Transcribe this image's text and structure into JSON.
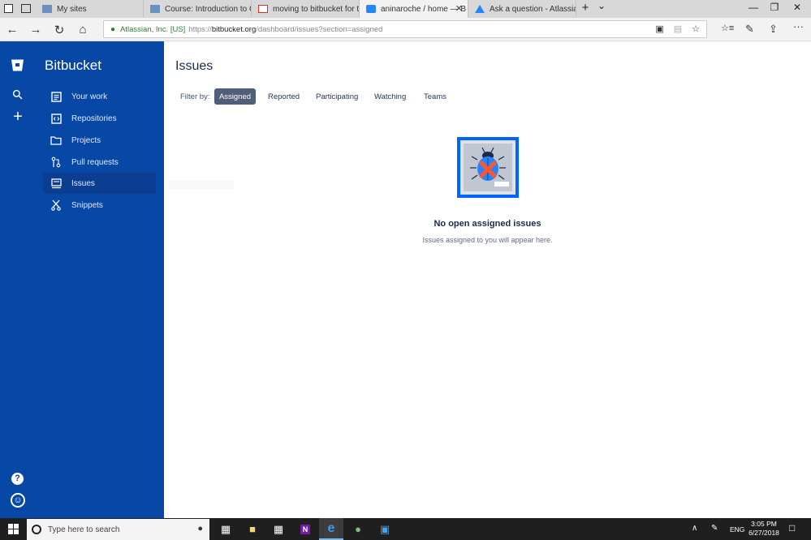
{
  "browser": {
    "tabs": [
      {
        "label": "My sites",
        "favicon": "ucla-icon"
      },
      {
        "label": "Course: Introduction to Gec",
        "favicon": "ucla-icon"
      },
      {
        "label": "moving to bitbucket for trac",
        "favicon": "gmail-icon"
      },
      {
        "label": "aninaroche / home — B",
        "favicon": "bitbucket-icon",
        "active": true
      },
      {
        "label": "Ask a question - Atlassian C",
        "favicon": "atlassian-icon"
      }
    ],
    "new_tab": "+",
    "tab_menu": "⌄",
    "window_controls": {
      "minimize": "—",
      "maximize": "❐",
      "close": "✕"
    },
    "nav": {
      "back": "←",
      "forward": "→",
      "refresh": "↻",
      "home": "⌂"
    },
    "address": {
      "org": "Atlassian, Inc. [US]",
      "scheme": "https://",
      "host": "bitbucket.org",
      "path": "/dashboard/issues?section=assigned"
    },
    "right_icons": {
      "reading": "▤",
      "favorite": "☆",
      "hub": "☆≡",
      "notes": "✎",
      "share": "⇪",
      "more": "···"
    }
  },
  "sidebar": {
    "brand": "Bitbucket",
    "rail": {
      "search": "⚲",
      "create": "+",
      "help": "?",
      "profile": "☺"
    },
    "items": [
      {
        "label": "Your work",
        "icon": "your-work-icon"
      },
      {
        "label": "Repositories",
        "icon": "repositories-icon"
      },
      {
        "label": "Projects",
        "icon": "projects-icon"
      },
      {
        "label": "Pull requests",
        "icon": "pull-requests-icon"
      },
      {
        "label": "Issues",
        "icon": "issues-icon",
        "active": true
      },
      {
        "label": "Snippets",
        "icon": "snippets-icon"
      }
    ],
    "color": "#0747a6"
  },
  "main": {
    "title": "Issues",
    "filter_label": "Filter by:",
    "filters": [
      {
        "label": "Assigned",
        "active": true
      },
      {
        "label": "Reported"
      },
      {
        "label": "Participating"
      },
      {
        "label": "Watching"
      },
      {
        "label": "Teams"
      }
    ],
    "empty_title": "No open assigned issues",
    "empty_subtitle": "Issues assigned to you will appear here."
  },
  "taskbar": {
    "search_placeholder": "Type here to search",
    "tray_lang": "ENG",
    "time": "3:05 PM",
    "date": "6/27/2018"
  }
}
